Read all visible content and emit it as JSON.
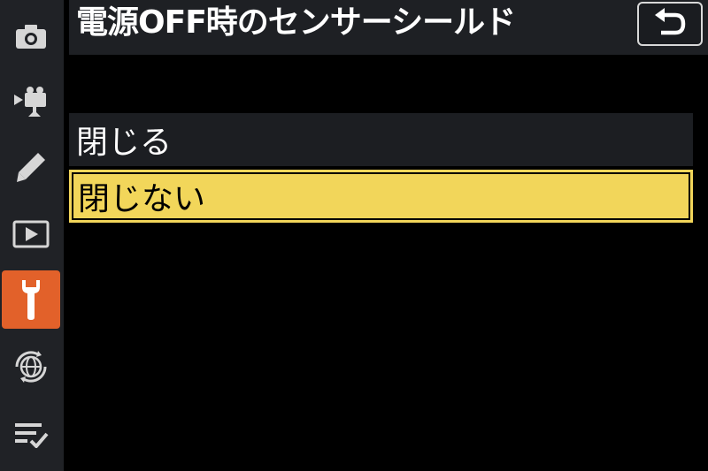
{
  "header": {
    "title": "電源OFF時のセンサーシールド",
    "back_icon": "return-icon"
  },
  "sidebar": {
    "items": [
      {
        "name": "photo-shooting-menu",
        "icon": "camera-icon",
        "active": false
      },
      {
        "name": "video-recording-menu",
        "icon": "video-camera-icon",
        "active": false
      },
      {
        "name": "custom-settings-menu",
        "icon": "pencil-icon",
        "active": false
      },
      {
        "name": "playback-menu",
        "icon": "play-icon",
        "active": false
      },
      {
        "name": "setup-menu",
        "icon": "wrench-icon",
        "active": true
      },
      {
        "name": "network-menu",
        "icon": "globe-network-icon",
        "active": false
      },
      {
        "name": "my-menu",
        "icon": "checklist-icon",
        "active": false
      }
    ],
    "active_color": "#e2612a"
  },
  "options": [
    {
      "label": "閉じる",
      "selected": false
    },
    {
      "label": "閉じない",
      "selected": true
    }
  ],
  "colors": {
    "highlight": "#f2d65a",
    "background": "#000000"
  }
}
